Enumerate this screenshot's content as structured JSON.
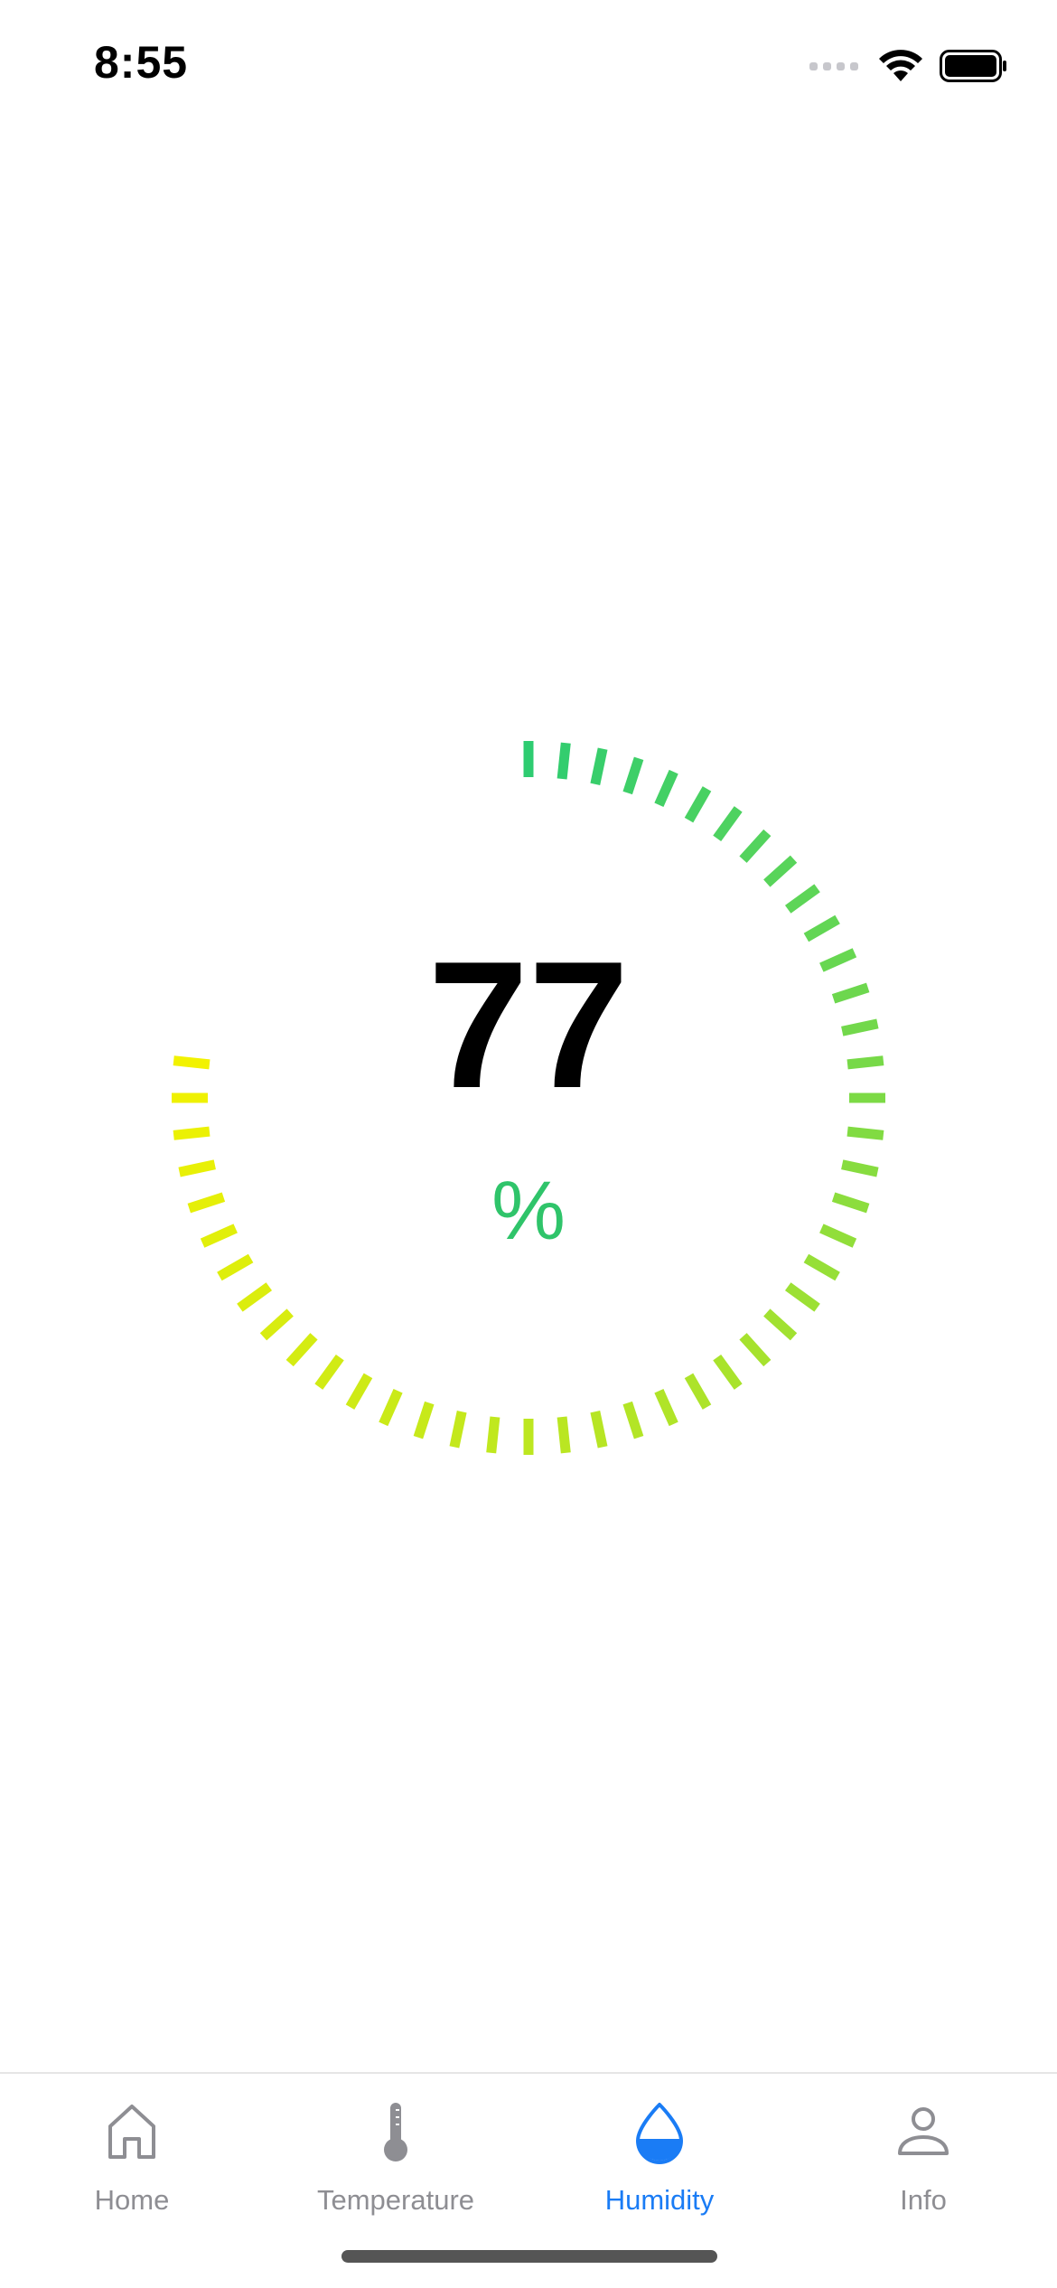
{
  "status_bar": {
    "time": "8:55"
  },
  "gauge": {
    "value": "77",
    "unit": "%",
    "level": 77,
    "colors": {
      "start": "#f2f200",
      "mid": "#a6e22e",
      "end": "#2ecc71",
      "unit": "#2fc46a"
    }
  },
  "tabs": [
    {
      "label": "Home",
      "icon": "home-icon",
      "active": false
    },
    {
      "label": "Temperature",
      "icon": "thermometer-icon",
      "active": false
    },
    {
      "label": "Humidity",
      "icon": "water-drop-icon",
      "active": true
    },
    {
      "label": "Info",
      "icon": "person-icon",
      "active": false
    }
  ],
  "accent_color": "#1a7cf5",
  "inactive_color": "#8e8e93"
}
